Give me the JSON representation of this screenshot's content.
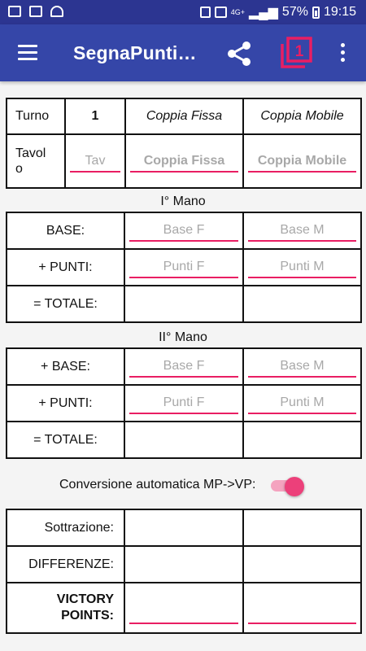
{
  "status_bar": {
    "network": "4G+",
    "battery": "57%",
    "time": "19:15"
  },
  "app_bar": {
    "title": "SegnaPunti…",
    "counter_value": "1",
    "accent_color": "#e91e63",
    "bar_color": "#3546a8"
  },
  "header_table": {
    "turno_label": "Turno",
    "turno_value": "1",
    "coppia_fissa_label": "Coppia Fissa",
    "coppia_mobile_label": "Coppia Mobile",
    "tavolo_label": "Tavolo",
    "tavolo_placeholder": "Tav",
    "coppia_fissa_placeholder": "Coppia Fissa",
    "coppia_mobile_placeholder": "Coppia Mobile"
  },
  "mano1": {
    "title": "I° Mano",
    "base_label": "BASE:",
    "punti_label": "+ PUNTI:",
    "totale_label": "= TOTALE:",
    "base_f_placeholder": "Base F",
    "base_m_placeholder": "Base M",
    "punti_f_placeholder": "Punti F",
    "punti_m_placeholder": "Punti M"
  },
  "mano2": {
    "title": "II° Mano",
    "base_label": "+ BASE:",
    "punti_label": "+ PUNTI:",
    "totale_label": "= TOTALE:",
    "base_f_placeholder": "Base F",
    "base_m_placeholder": "Base M",
    "punti_f_placeholder": "Punti F",
    "punti_m_placeholder": "Punti M"
  },
  "conversion": {
    "label": "Conversione automatica MP->VP:",
    "enabled": true
  },
  "results_table": {
    "sottrazione_label": "Sottrazione:",
    "differenze_label": "DIFFERENZE:",
    "victory_label_line1": "VICTORY",
    "victory_label_line2": "POINTS:"
  }
}
